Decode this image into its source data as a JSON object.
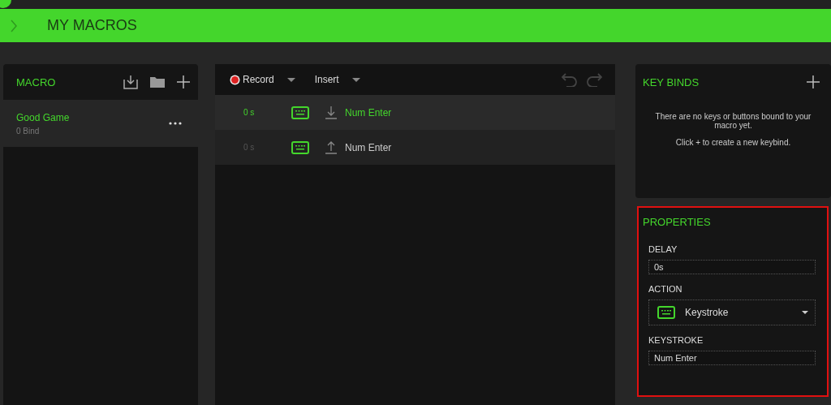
{
  "header": {
    "title": "MY MACROS"
  },
  "macro_panel": {
    "title": "MACRO",
    "macros": [
      {
        "name": "Good Game",
        "binds": "0 Bind",
        "selected": true
      }
    ]
  },
  "editor": {
    "record": "Record",
    "insert": "Insert",
    "rows": [
      {
        "delay": "0 s",
        "kind": "press",
        "key": "Num Enter",
        "selected": true
      },
      {
        "delay": "0 s",
        "kind": "release",
        "key": "Num Enter",
        "selected": false
      }
    ]
  },
  "key_binds": {
    "title": "KEY BINDS",
    "message": "There are no keys or buttons bound to your macro yet.",
    "hint": "Click + to create a new keybind."
  },
  "properties": {
    "title": "PROPERTIES",
    "highlighted": true,
    "delay_label": "DELAY",
    "delay": "0s",
    "action_label": "ACTION",
    "action": "Keystroke",
    "keystroke_label": "KEYSTROKE",
    "keystroke": "Num Enter"
  }
}
